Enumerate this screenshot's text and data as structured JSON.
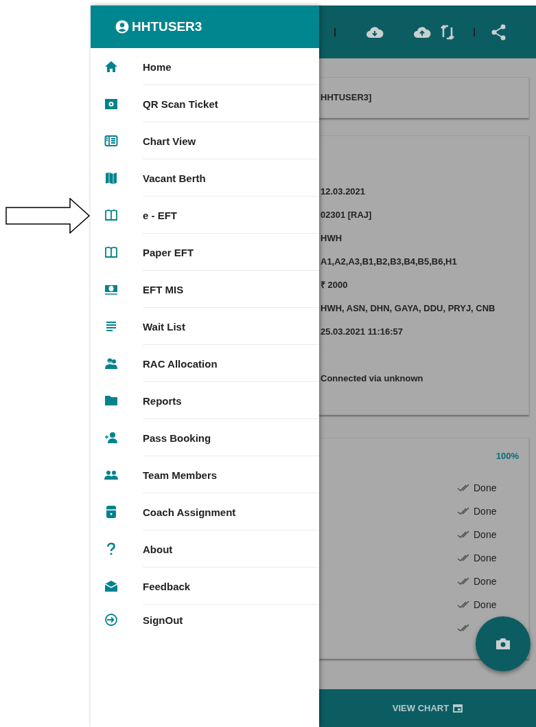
{
  "drawer": {
    "user": "HHTUSER3",
    "items": [
      {
        "label": "Home",
        "kind": "home"
      },
      {
        "label": "QR Scan Ticket",
        "kind": "camera"
      },
      {
        "label": "Chart View",
        "kind": "newspaper"
      },
      {
        "label": "Vacant Berth",
        "kind": "map"
      },
      {
        "label": "e - EFT",
        "kind": "book"
      },
      {
        "label": "Paper EFT",
        "kind": "book"
      },
      {
        "label": "EFT MIS",
        "kind": "cash"
      },
      {
        "label": "Wait List",
        "kind": "lines"
      },
      {
        "label": "RAC Allocation",
        "kind": "people"
      },
      {
        "label": "Reports",
        "kind": "folder"
      },
      {
        "label": "Pass Booking",
        "kind": "addperson"
      },
      {
        "label": "Team Members",
        "kind": "group"
      },
      {
        "label": "Coach Assignment",
        "kind": "coach"
      },
      {
        "label": "About",
        "kind": "help"
      },
      {
        "label": "Feedback",
        "kind": "mail"
      },
      {
        "label": "SignOut",
        "kind": "signout"
      }
    ]
  },
  "user_card": {
    "text": "HHTUSER3]"
  },
  "details_card": {
    "values": [
      "12.03.2021",
      "02301 [RAJ]",
      "HWH",
      "A1,A2,A3,B1,B2,B3,B4,B5,B6,H1",
      "₹ 2000",
      "HWH, ASN, DHN, GAYA, DDU, PRYJ, CNB",
      "25.03.2021 11:16:57",
      "Connected via unknown"
    ]
  },
  "progress_card": {
    "percent": "100%",
    "steps": [
      "Done",
      "Done",
      "Done",
      "Done",
      "Done",
      "Done"
    ]
  },
  "bottom_bar": {
    "label": "VIEW CHART"
  }
}
